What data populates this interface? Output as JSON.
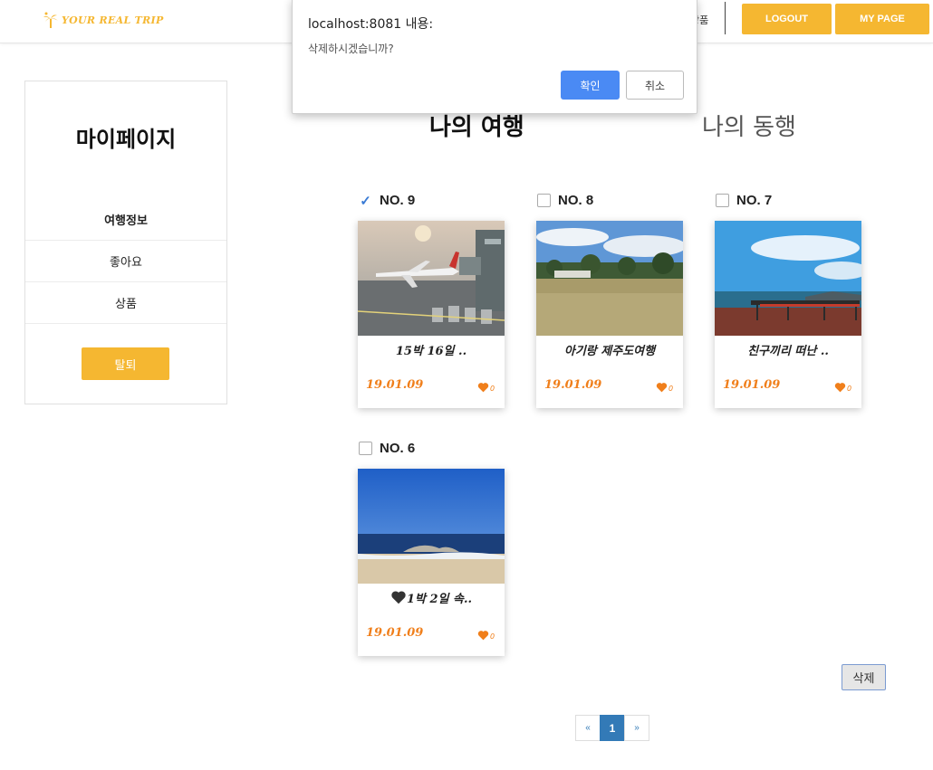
{
  "header": {
    "logo_text": "YOUR REAL TRIP",
    "nav_partial": "상품",
    "logout_label": "LOGOUT",
    "mypage_label": "MY PAGE"
  },
  "sidebar": {
    "title": "마이페이지",
    "items": [
      {
        "label": "여행정보",
        "active": true
      },
      {
        "label": "좋아요",
        "active": false
      },
      {
        "label": "상품",
        "active": false
      }
    ],
    "withdraw_label": "탈퇴"
  },
  "tabs": {
    "my_trip": "나의 여행",
    "companion": "나의 동행"
  },
  "cards": [
    {
      "no": "NO. 9",
      "checked": true,
      "title": "15박 16일 ..",
      "date": "19.01.09",
      "likes": "0",
      "photo": "airport-icon"
    },
    {
      "no": "NO. 8",
      "checked": false,
      "title": "아기랑 제주도여행",
      "date": "19.01.09",
      "likes": "0",
      "photo": "field-icon"
    },
    {
      "no": "NO. 7",
      "checked": false,
      "title": "친구끼리 떠난 ..",
      "date": "19.01.09",
      "likes": "0",
      "photo": "seaside-terrace-icon"
    },
    {
      "no": "NO. 6",
      "checked": false,
      "title": "1박 2일 속..",
      "date": "19.01.09",
      "likes": "0",
      "photo": "beach-icon"
    }
  ],
  "delete_label": "삭제",
  "pagination": {
    "prev": "«",
    "current": "1",
    "next": "»"
  },
  "dialog": {
    "title": "localhost:8081 내용:",
    "message": "삭제하시겠습니까?",
    "ok_label": "확인",
    "cancel_label": "취소"
  },
  "colors": {
    "accent": "#f5b731",
    "date": "#f07f1b",
    "pager": "#337ab7",
    "confirm": "#4a8af4"
  }
}
